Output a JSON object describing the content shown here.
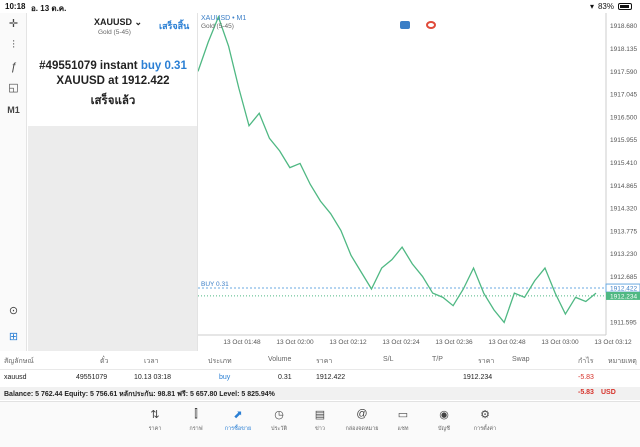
{
  "status": {
    "time": "10:18",
    "date": "อ. 13 ต.ค.",
    "battery": "83%"
  },
  "panel": {
    "symbol": "XAUUSD",
    "symbol_sub": "Gold (5-45)",
    "done": "เสร็จสิ้น",
    "order_prefix": "#49551079 instant ",
    "order_side": "buy 0.31",
    "line2": "XAUUSD at 1912.422",
    "status": "เสร็จแล้ว"
  },
  "chart_title": "XAUUSD • M1",
  "chart_sub": "Gold (5-45)",
  "chart_data": {
    "type": "line",
    "x": [
      "13 Oct 01:48",
      "13 Oct 02:00",
      "13 Oct 02:12",
      "13 Oct 02:24",
      "13 Oct 02:36",
      "13 Oct 02:48",
      "13 Oct 03:00",
      "13 Oct 03:12"
    ],
    "ylim": [
      1911.3,
      1918.9
    ],
    "yticks": [
      "1918.680",
      "1918.135",
      "1917.590",
      "1917.045",
      "1916.500",
      "1915.955",
      "1915.410",
      "1914.865",
      "1914.320",
      "1913.775",
      "1913.230",
      "1912.685",
      "1912.422",
      "1912.234",
      "1911.595"
    ],
    "series": [
      {
        "values": [
          1917.6,
          1918.3,
          1918.9,
          1918.2,
          1917.2,
          1916.3,
          1916.6,
          1916.0,
          1915.7,
          1915.3,
          1915.4,
          1914.9,
          1914.5,
          1914.2,
          1913.8,
          1913.2,
          1912.8,
          1912.4,
          1912.9,
          1913.1,
          1913.4,
          1913.0,
          1912.7,
          1912.3,
          1912.2,
          1912.0,
          1912.4,
          1912.9,
          1912.3,
          1911.9,
          1911.6,
          1912.3,
          1912.2,
          1912.6,
          1912.9,
          1912.3,
          1911.8,
          1912.2,
          1912.1,
          1912.3
        ]
      }
    ],
    "buy_label": "BUY 0.31",
    "buy_price": 1912.422,
    "current_price": 1912.234
  },
  "table": {
    "headers": [
      "สัญลักษณ์",
      "ตั๋ว",
      "เวลา",
      "ประเภท",
      "Volume",
      "ราคา",
      "S/L",
      "T/P",
      "ราคา",
      "Swap",
      "กำไร",
      "หมายเหตุ"
    ],
    "row": {
      "symbol": "xauusd",
      "ticket": "49551079",
      "time": "10.13 03:18",
      "type": "buy",
      "volume": "0.31",
      "price": "1912.422",
      "price_now": "1912.234",
      "profit": "-5.83"
    },
    "balance": "Balance: 5 762.44 Equity: 5 756.61 หลักประกัน: 98.81 ฟรี: 5 657.80 Level: 5 825.94%",
    "total": "-5.83",
    "currency": "USD"
  },
  "nav": [
    {
      "label": "ราคา",
      "icon": "quotes-icon"
    },
    {
      "label": "กราฟ",
      "icon": "chart-icon"
    },
    {
      "label": "การซื้อขาย",
      "icon": "trade-icon"
    },
    {
      "label": "ประวัติ",
      "icon": "history-icon"
    },
    {
      "label": "ข่าว",
      "icon": "news-icon"
    },
    {
      "label": "กล่องจดหมาย",
      "icon": "mailbox-icon"
    },
    {
      "label": "แชท",
      "icon": "chat-icon"
    },
    {
      "label": "บัญชี",
      "icon": "account-icon"
    },
    {
      "label": "การตั้งค่า",
      "icon": "settings-icon"
    }
  ],
  "colors": {
    "line": "#4fb883",
    "accent": "#2a7fd4",
    "loss": "#d6322a"
  }
}
